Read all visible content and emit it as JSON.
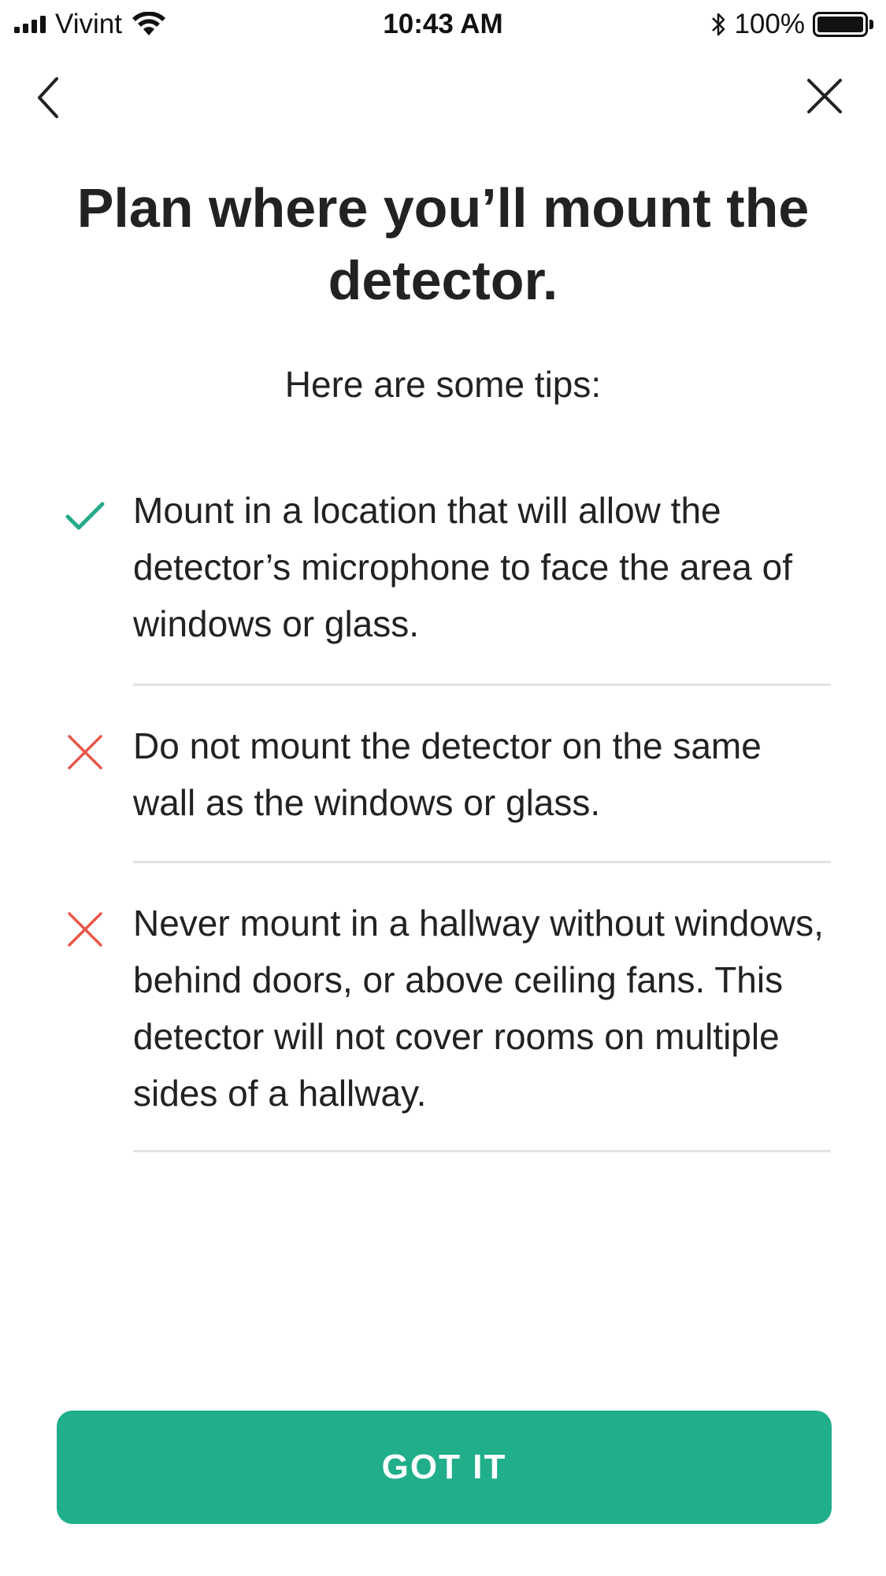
{
  "status_bar": {
    "carrier": "Vivint",
    "time": "10:43 AM",
    "battery_percent": "100%",
    "battery_level": 1.0,
    "signal_bars": 4,
    "icons": [
      "signal-icon",
      "wifi-icon",
      "bluetooth-icon",
      "battery-icon"
    ]
  },
  "nav": {
    "back_icon": "chevron-left-icon",
    "close_icon": "close-icon"
  },
  "page": {
    "title": "Plan where you’ll mount the detector.",
    "subtitle": "Here are some tips:"
  },
  "tips": [
    {
      "type": "do",
      "icon": "checkmark-icon",
      "text": "Mount in a location that will allow the detector’s microphone to face the area of windows or glass."
    },
    {
      "type": "dont",
      "icon": "x-icon",
      "text": "Do not mount the detector on the same wall as the windows or glass."
    },
    {
      "type": "dont",
      "icon": "x-icon",
      "text": "Never mount in a hallway without windows, behind doors, or above ceiling fans. This detector will not cover rooms on multiple sides of a hallway."
    }
  ],
  "button": {
    "label": "GOT IT"
  },
  "colors": {
    "accent_green": "#20ae8b",
    "check_green": "#25a98a",
    "x_red": "#e8564a",
    "divider": "#e3e3e3",
    "text": "#222222"
  }
}
